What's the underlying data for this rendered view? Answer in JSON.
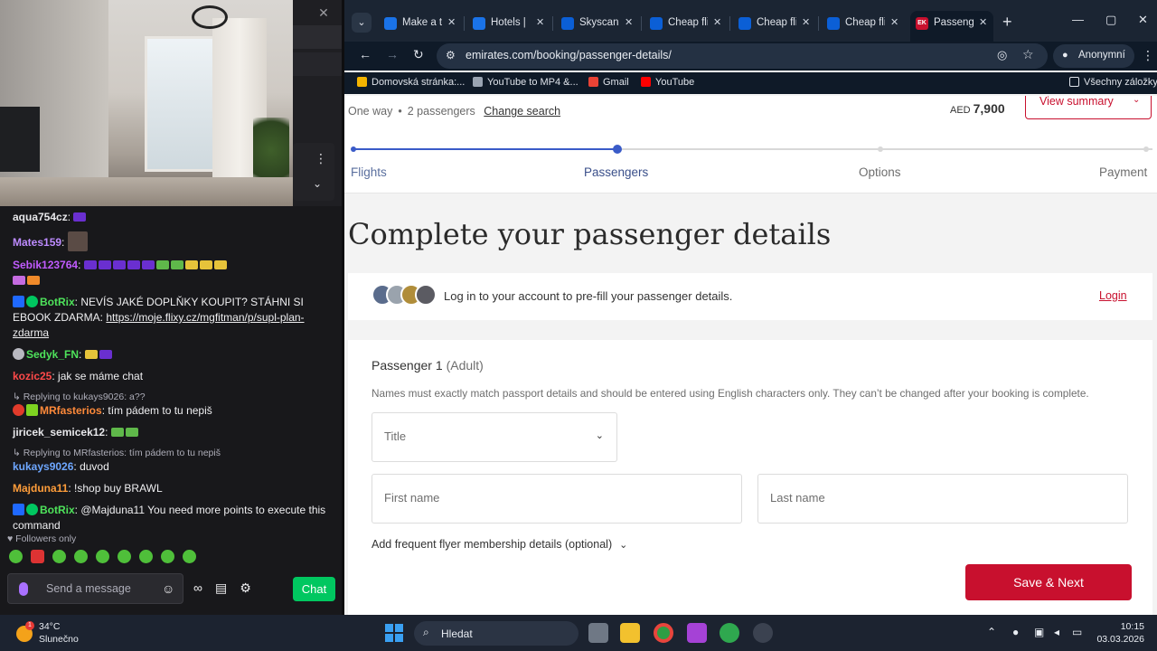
{
  "chat": {
    "messages": [
      {
        "user": "aqua754cz",
        "user_color": "#e7e7ea",
        "text": ""
      },
      {
        "user": "Mates159",
        "user_color": "#bd8bff",
        "text": ""
      },
      {
        "user": "Sebik123764",
        "user_color": "#c15bff",
        "text": ""
      },
      {
        "user": "BotRix",
        "user_color": "#4ee35b",
        "text": "NEVÍS JAKÉ DOPLŇKY KOUPIT? STÁHNI SI EBOOK ZDARMA:",
        "link": "https://moje.flixy.cz/mgfitman/p/supl-plan-zdarma"
      },
      {
        "user": "Sedyk_FN",
        "user_color": "#4ee35b",
        "text": ""
      },
      {
        "user": "kozic25",
        "user_color": "#ff4a4a",
        "text": "jak se máme chat"
      },
      {
        "reply": "Replying to kukays9026: a??",
        "user": "MRfasterios",
        "user_color": "#ff8a3a",
        "text": "tím pádem to tu nepiš"
      },
      {
        "user": "jiricek_semicek12",
        "user_color": "#e7e7ea",
        "text": ""
      },
      {
        "reply": "Replying to MRfasterios: tím pádem to tu nepiš",
        "user": "kukays9026",
        "user_color": "#6ea7ff",
        "text": "duvod"
      },
      {
        "user": "Majduna11",
        "user_color": "#ff9d3a",
        "text": "!shop buy BRAWL"
      },
      {
        "user": "BotRix",
        "user_color": "#4ee35b",
        "text": "@Majduna11 You need more points to execute this command"
      }
    ],
    "followers_only": "Followers only",
    "input_placeholder": "Send a message",
    "chat_button": "Chat"
  },
  "browser": {
    "tabs": [
      {
        "title": "Make a t",
        "icon": "plane-icon"
      },
      {
        "title": "Hotels |",
        "icon": "booking-icon"
      },
      {
        "title": "Skyscann",
        "icon": "skyscanner-icon"
      },
      {
        "title": "Cheap fli",
        "icon": "skyscanner-icon"
      },
      {
        "title": "Cheap fli",
        "icon": "skyscanner-icon"
      },
      {
        "title": "Cheap fli",
        "icon": "skyscanner-icon"
      },
      {
        "title": "Passeng",
        "icon": "emirates-icon",
        "favicon_text": "EK",
        "active": true
      }
    ],
    "url": "emirates.com/booking/passenger-details/",
    "profile": "Anonymní",
    "bookmarks": [
      {
        "label": "Domovská stránka:...",
        "color": "#f4b400"
      },
      {
        "label": "YouTube to MP4 &...",
        "color": "#9aa4b2"
      },
      {
        "label": "Gmail",
        "color": "#ea4335"
      },
      {
        "label": "YouTube",
        "color": "#ff0000"
      }
    ],
    "bookmarks_all": "Všechny záložky"
  },
  "page": {
    "trip_type": "One way",
    "passengers": "2 passengers",
    "change_search": "Change search",
    "currency": "AED",
    "price": "7,900",
    "view_summary": "View summary",
    "steps": [
      "Flights",
      "Passengers",
      "Options",
      "Payment"
    ],
    "current_step": 1,
    "heading": "Complete your passenger details",
    "login_prompt": "Log in to your account to pre-fill your passenger details.",
    "login_link": "Login",
    "passenger_label": "Passenger 1",
    "passenger_type": "(Adult)",
    "note": "Names must exactly match passport details and should be entered using English characters only. They can’t be changed after your booking is complete.",
    "title_placeholder": "Title",
    "first_name_placeholder": "First name",
    "last_name_placeholder": "Last name",
    "frequent_flyer": "Add frequent flyer membership details (optional)",
    "save_next": "Save & Next",
    "accent_color": "#c8102e"
  },
  "taskbar": {
    "temperature": "34°C",
    "condition": "Slunečno",
    "weather_badge": "1",
    "search_label": "Hledat",
    "time": "10:15",
    "date": "03.03.2026"
  }
}
